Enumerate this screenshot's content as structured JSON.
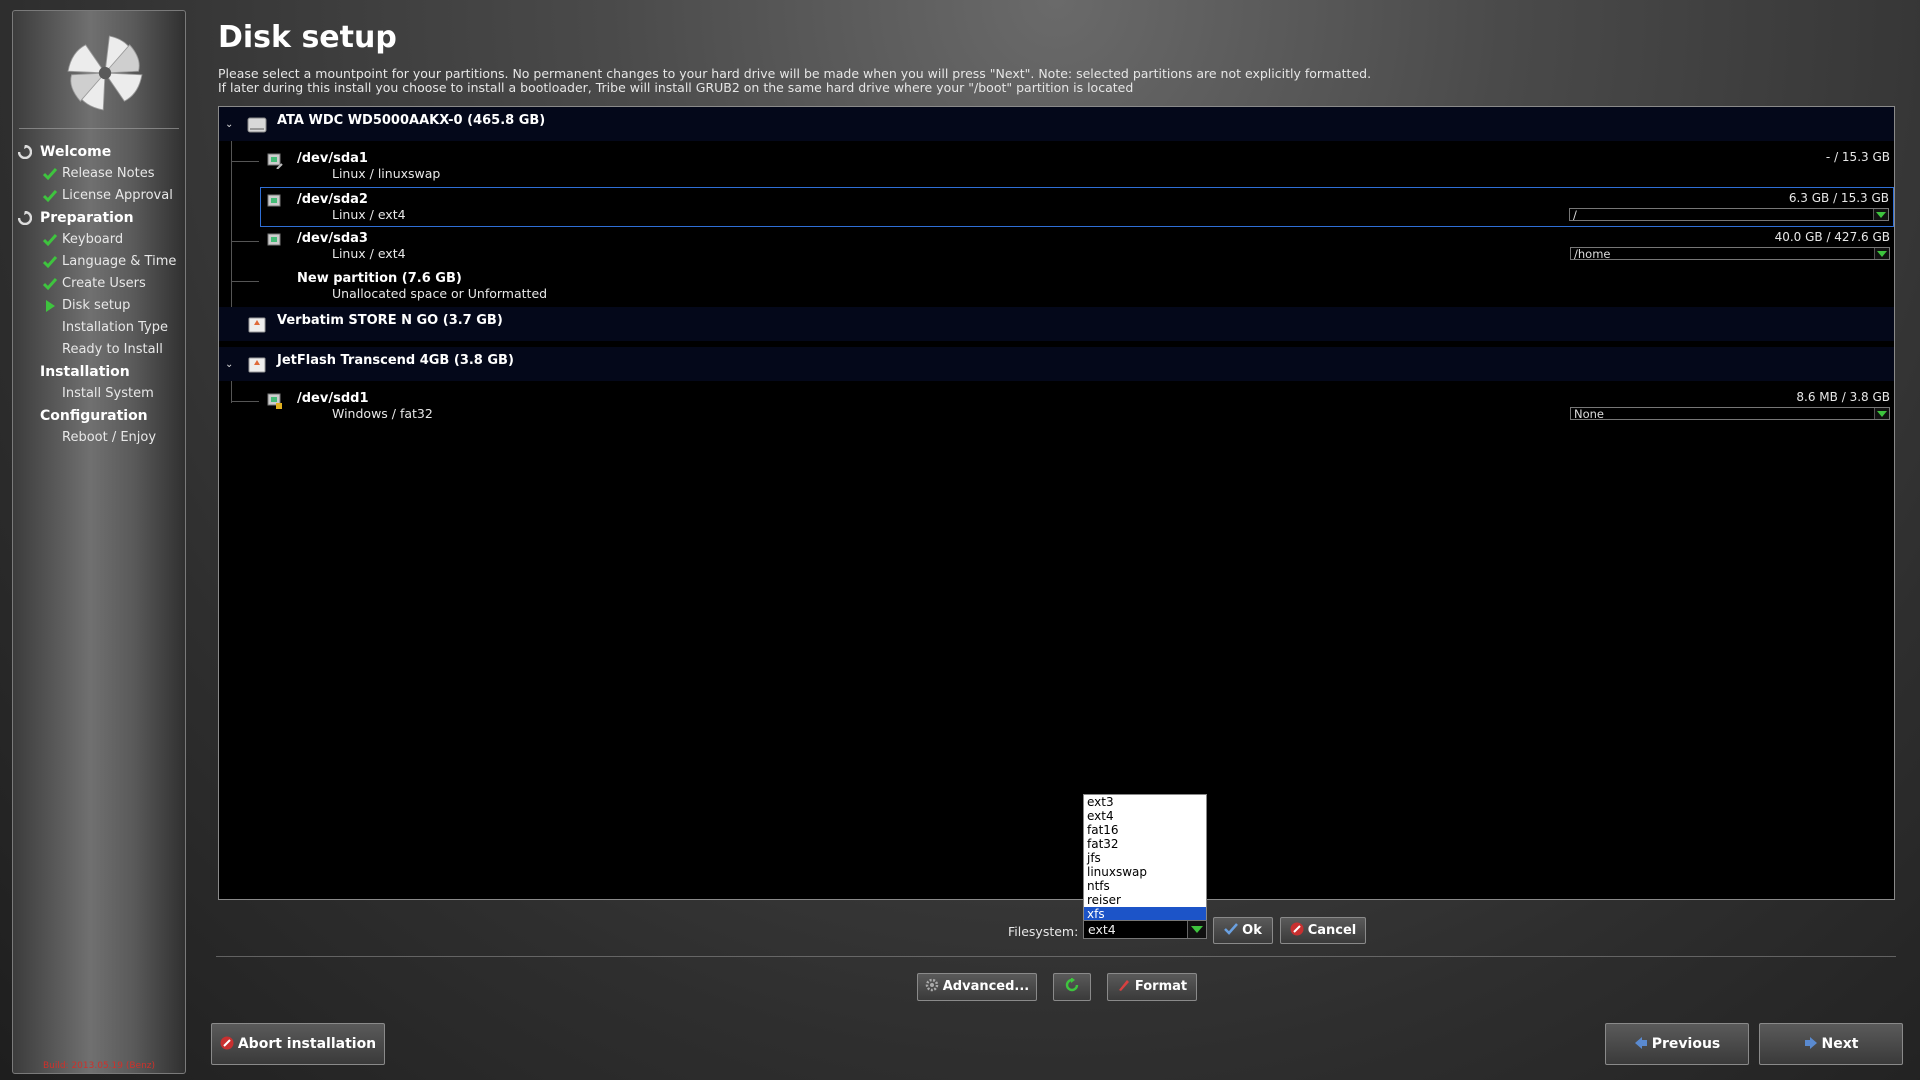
{
  "sidebar": {
    "sections": [
      {
        "label": "Welcome",
        "icon": "refresh-icon",
        "items": [
          {
            "label": "Release Notes",
            "status": "done"
          },
          {
            "label": "License Approval",
            "status": "done"
          }
        ]
      },
      {
        "label": "Preparation",
        "icon": "refresh-icon",
        "items": [
          {
            "label": "Keyboard",
            "status": "done"
          },
          {
            "label": "Language & Time",
            "status": "done"
          },
          {
            "label": "Create Users",
            "status": "done"
          },
          {
            "label": "Disk setup",
            "status": "current"
          },
          {
            "label": "Installation Type",
            "status": "pending"
          },
          {
            "label": "Ready to Install",
            "status": "pending"
          }
        ]
      },
      {
        "label": "Installation",
        "icon": "",
        "items": [
          {
            "label": "Install System",
            "status": "pending"
          }
        ]
      },
      {
        "label": "Configuration",
        "icon": "",
        "items": [
          {
            "label": "Reboot / Enjoy",
            "status": "pending"
          }
        ]
      }
    ],
    "build": "Build: 2013.05.19 (Benz)"
  },
  "header": {
    "title": "Disk setup",
    "desc_line1": "Please select a mountpoint for your partitions. No permanent changes to your hard drive will be made when you will press \"Next\". Note: selected partitions are not explicitly formatted.",
    "desc_line2": "If later during this install you choose to install a bootloader, Tribe will install GRUB2 on the same hard drive where your \"/boot\" partition is located"
  },
  "tree": {
    "drive1": {
      "label": "ATA WDC WD5000AAKX-0  (465.8 GB)"
    },
    "sda1": {
      "name": "/dev/sda1",
      "fs": "Linux / linuxswap",
      "size": "- / 15.3 GB"
    },
    "sda2": {
      "name": "/dev/sda2",
      "fs": "Linux / ext4",
      "size": "6.3 GB / 15.3 GB",
      "mount": "/"
    },
    "sda3": {
      "name": "/dev/sda3",
      "fs": "Linux / ext4",
      "size": "40.0 GB / 427.6 GB",
      "mount": "/home"
    },
    "newpart": {
      "name": "New partition  (7.6 GB)",
      "fs": "Unallocated space or Unformatted"
    },
    "drive2": {
      "label": "Verbatim STORE N GO  (3.7 GB)"
    },
    "drive3": {
      "label": "JetFlash Transcend 4GB  (3.8 GB)"
    },
    "sdd1": {
      "name": "/dev/sdd1",
      "fs": "Windows / fat32",
      "size": "8.6 MB / 3.8 GB",
      "mount": "None"
    }
  },
  "filesystem": {
    "label": "Filesystem:",
    "value": "ext4",
    "options": [
      "ext3",
      "ext4",
      "fat16",
      "fat32",
      "jfs",
      "linuxswap",
      "ntfs",
      "reiser",
      "xfs"
    ],
    "highlighted": "xfs"
  },
  "buttons": {
    "ok": "Ok",
    "cancel": "Cancel",
    "advanced": "Advanced...",
    "format": "Format",
    "abort": "Abort installation",
    "previous": "Previous",
    "next": "Next"
  },
  "colors": {
    "accent": "#2f6fd6",
    "check": "#3ec43e",
    "danger": "#d0302a"
  }
}
